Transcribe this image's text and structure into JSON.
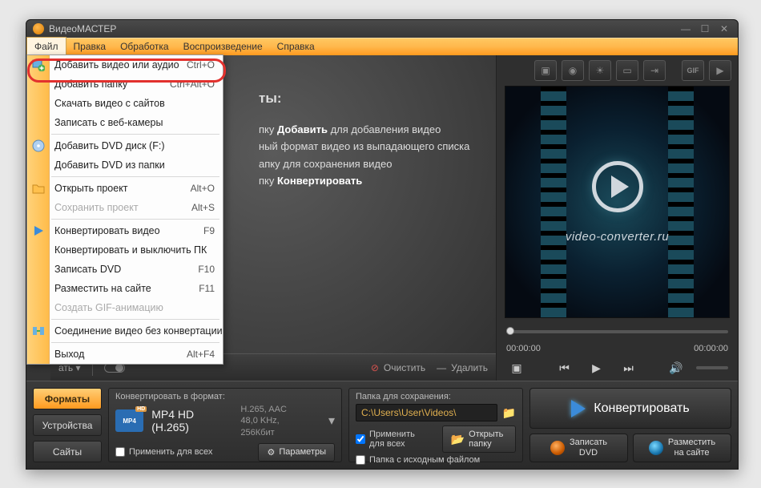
{
  "titlebar": {
    "title": "ВидеоМАСТЕР"
  },
  "menubar": [
    "Файл",
    "Правка",
    "Обработка",
    "Воспроизведение",
    "Справка"
  ],
  "dropdown": {
    "items": [
      {
        "label": "Добавить видео или аудио",
        "shortcut": "Ctrl+O",
        "icon": "add"
      },
      {
        "label": "Добавить папку",
        "shortcut": "Ctrl+Alt+O"
      },
      {
        "label": "Скачать видео с сайтов"
      },
      {
        "label": "Записать с веб-камеры"
      },
      {
        "sep": true
      },
      {
        "label": "Добавить DVD диск (F:)",
        "icon": "dvd"
      },
      {
        "label": "Добавить DVD из папки"
      },
      {
        "sep": true
      },
      {
        "label": "Открыть проект",
        "shortcut": "Alt+O",
        "icon": "folder"
      },
      {
        "label": "Сохранить проект",
        "shortcut": "Alt+S",
        "disabled": true
      },
      {
        "sep": true
      },
      {
        "label": "Конвертировать видео",
        "shortcut": "F9",
        "icon": "play"
      },
      {
        "label": "Конвертировать и выключить ПК"
      },
      {
        "label": "Записать DVD",
        "shortcut": "F10"
      },
      {
        "label": "Разместить на сайте",
        "shortcut": "F11"
      },
      {
        "label": "Создать GIF-анимацию",
        "disabled": true
      },
      {
        "sep": true
      },
      {
        "label": "Соединение видео без конвертации",
        "icon": "join"
      },
      {
        "sep": true
      },
      {
        "label": "Выход",
        "shortcut": "Alt+F4"
      }
    ]
  },
  "instructions": {
    "heading_suffix": "ты:",
    "step1_a": "пку ",
    "step1_b": "Добавить",
    "step1_c": " для добавления видео",
    "step2": "ный формат видео из выпадающего списка",
    "step3": "апку для сохранения видео",
    "step4_a": "пку ",
    "step4_b": "Конвертировать"
  },
  "bottombar": {
    "add": "ать ▾",
    "clear": "Очистить",
    "delete": "Удалить"
  },
  "preview": {
    "watermark": "video-converter.ru",
    "t_start": "00:00:00",
    "t_end": "00:00:00"
  },
  "footer": {
    "tabs": [
      "Форматы",
      "Устройства",
      "Сайты"
    ],
    "format_label": "Конвертировать в формат:",
    "format_name": "MP4 HD  (H.265)",
    "format_codec": "H.265, AAC",
    "format_rate": "48,0 KHz,  256Кбит",
    "apply_all": "Применить для всех",
    "params_btn": "Параметры",
    "folder_label": "Папка для сохранения:",
    "folder_path": "C:\\Users\\User\\Videos\\",
    "keep_source": "Папка с исходным файлом",
    "open_folder": "Открыть папку",
    "convert": "Конвертировать",
    "burn_dvd": "Записать\nDVD",
    "publish": "Разместить\nна сайте",
    "mp4badge": "MP4"
  }
}
